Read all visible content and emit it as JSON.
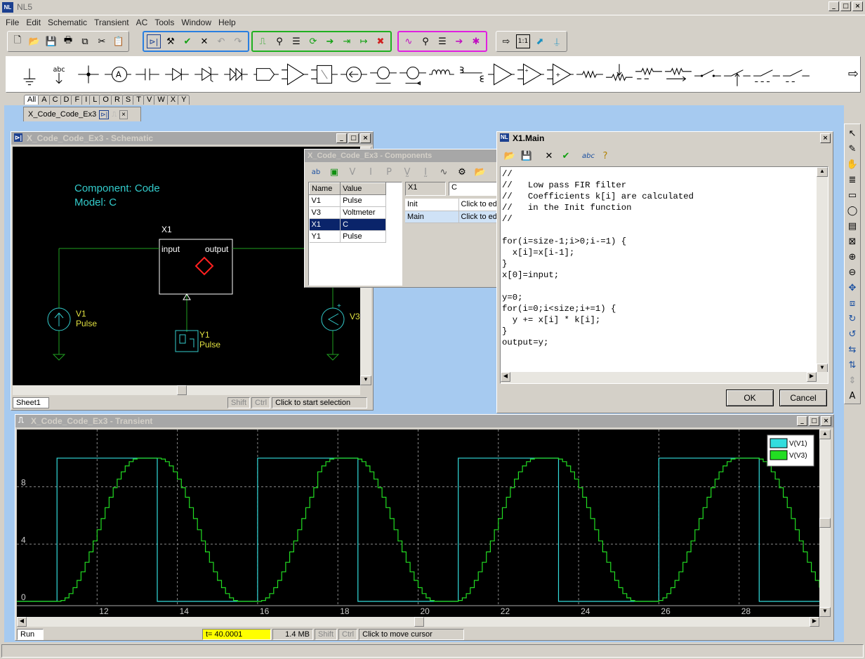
{
  "app": {
    "title": "NL5"
  },
  "menu": [
    "File",
    "Edit",
    "Schematic",
    "Transient",
    "AC",
    "Tools",
    "Window",
    "Help"
  ],
  "library_tabs": [
    "All",
    "A",
    "C",
    "D",
    "F",
    "I",
    "L",
    "O",
    "R",
    "S",
    "T",
    "V",
    "W",
    "X",
    "Y"
  ],
  "doc_tab": {
    "label": "X_Code_Code_Ex3"
  },
  "schematic": {
    "title": "X_Code_Code_Ex3 - Schematic",
    "component_line": "Component: Code",
    "model_line": "Model: C",
    "x1": "X1",
    "input": "input",
    "output": "output",
    "v1": "V1",
    "v1_model": "Pulse",
    "y1": "Y1",
    "y1_model": "Pulse",
    "v3": "V3",
    "sheet_tab": "Sheet1",
    "shift": "Shift",
    "ctrl": "Ctrl",
    "status": "Click to start selection"
  },
  "components": {
    "title": "X_Code_Code_Ex3 - Components",
    "headers": [
      "Name",
      "Value"
    ],
    "rows": [
      [
        "V1",
        "Pulse"
      ],
      [
        "V3",
        "Voltmeter"
      ],
      [
        "X1",
        "C"
      ],
      [
        "Y1",
        "Pulse"
      ]
    ],
    "selected_name": "X1",
    "selected_value": "C",
    "props": [
      [
        "Init",
        "Click to ed"
      ],
      [
        "Main",
        "Click to ed"
      ]
    ]
  },
  "editor": {
    "title": "X1.Main",
    "code": "//\n//   Low pass FIR filter\n//   Coefficients k[i] are calculated\n//   in the Init function\n//\n\nfor(i=size-1;i>0;i-=1) {\n  x[i]=x[i-1];\n}\nx[0]=input;\n\ny=0;\nfor(i=0;i<size;i+=1) {\n  y += x[i] * k[i];\n}\noutput=y;",
    "ok": "OK",
    "cancel": "Cancel"
  },
  "transient": {
    "title": "X_Code_Code_Ex3 - Transient",
    "run_tab": "Run",
    "time": "t= 40.0001",
    "memory": "1.4 MB",
    "shift": "Shift",
    "ctrl": "Ctrl",
    "status": "Click to move cursor"
  },
  "chart_data": {
    "type": "line",
    "x_ticks": [
      12,
      14,
      16,
      18,
      20,
      22,
      24,
      26,
      28
    ],
    "y_ticks": [
      0,
      4,
      8
    ],
    "xlim": [
      10.0,
      30.0
    ],
    "ylim": [
      -0.3,
      12.0
    ],
    "grid": true,
    "legend_position": "top-right",
    "series": [
      {
        "name": "V(V1)",
        "color": "#33dddd",
        "kind": "pulse",
        "high": 10,
        "low": 0,
        "period": 5,
        "first_rise": 11.0,
        "width": 2.5
      },
      {
        "name": "V(V3)",
        "color": "#22dd22",
        "kind": "filtered",
        "high": 10,
        "low": 0,
        "period": 5,
        "first_rise": 11.0,
        "width": 2.5,
        "delay_steps": 20,
        "step": 0.1
      }
    ]
  }
}
